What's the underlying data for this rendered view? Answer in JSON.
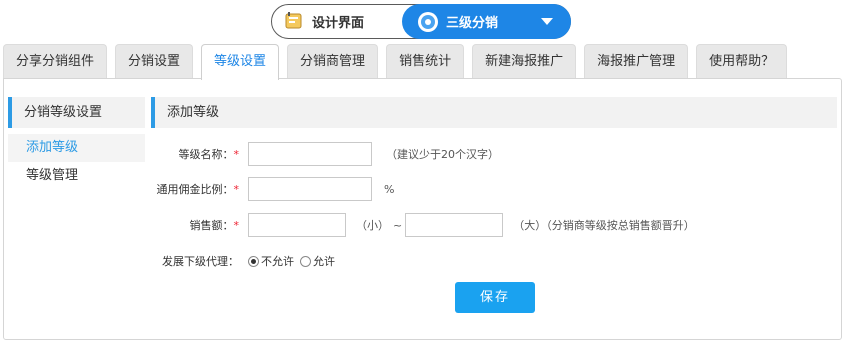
{
  "top_switch": {
    "left_label": "设计界面",
    "right_label": "三级分销"
  },
  "tabs": [
    {
      "label": "分享分销组件",
      "active": false
    },
    {
      "label": "分销设置",
      "active": false
    },
    {
      "label": "等级设置",
      "active": true
    },
    {
      "label": "分销商管理",
      "active": false
    },
    {
      "label": "销售统计",
      "active": false
    },
    {
      "label": "新建海报推广",
      "active": false
    },
    {
      "label": "海报推广管理",
      "active": false
    },
    {
      "label": "使用帮助？",
      "active": false
    }
  ],
  "sidebar": {
    "title": "分销等级设置",
    "items": [
      {
        "label": "添加等级",
        "active": true
      },
      {
        "label": "等级管理",
        "active": false
      }
    ]
  },
  "form": {
    "title": "添加等级",
    "level_name": {
      "label": "等级名称：",
      "required": "*",
      "value": "",
      "hint": "（建议少于20个汉字）"
    },
    "commission": {
      "label": "通用佣金比例：",
      "required": "*",
      "value": "",
      "unit": "%"
    },
    "sales": {
      "label": "销售额：",
      "required": "*",
      "min_value": "",
      "min_hint": "（小）",
      "separator": "~",
      "max_value": "",
      "max_hint": "（大）（分销商等级按总销售额晋升）"
    },
    "sub_agent": {
      "label": "发展下级代理：",
      "options": [
        {
          "label": "不允许",
          "checked": true
        },
        {
          "label": "允许",
          "checked": false
        }
      ]
    },
    "save_label": "保存"
  },
  "colors": {
    "accent": "#1e86e6",
    "button": "#1aa2f0",
    "required": "#ee2233"
  }
}
